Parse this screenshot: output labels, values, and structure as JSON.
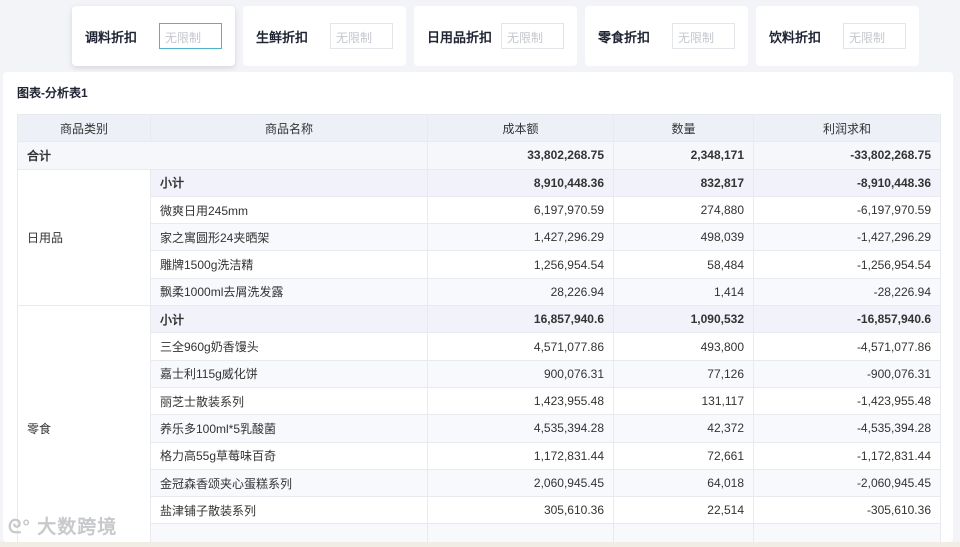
{
  "filters": [
    {
      "label": "调料折扣",
      "placeholder": "无限制"
    },
    {
      "label": "生鲜折扣",
      "placeholder": "无限制"
    },
    {
      "label": "日用品折扣",
      "placeholder": "无限制"
    },
    {
      "label": "零食折扣",
      "placeholder": "无限制"
    },
    {
      "label": "饮料折扣",
      "placeholder": "无限制"
    }
  ],
  "panel_title": "图表-分析表1",
  "columns": [
    "商品类别",
    "商品名称",
    "成本额",
    "数量",
    "利润求和"
  ],
  "total": {
    "label": "合计",
    "cost": "33,802,268.75",
    "qty": "2,348,171",
    "profit": "-33,802,268.75"
  },
  "groups": [
    {
      "category": "日用品",
      "subtotal": {
        "label": "小计",
        "cost": "8,910,448.36",
        "qty": "832,817",
        "profit": "-8,910,448.36"
      },
      "rows": [
        {
          "name": "微爽日用245mm",
          "cost": "6,197,970.59",
          "qty": "274,880",
          "profit": "-6,197,970.59"
        },
        {
          "name": "家之寓圆形24夹晒架",
          "cost": "1,427,296.29",
          "qty": "498,039",
          "profit": "-1,427,296.29"
        },
        {
          "name": "雕牌1500g洗洁精",
          "cost": "1,256,954.54",
          "qty": "58,484",
          "profit": "-1,256,954.54"
        },
        {
          "name": "飘柔1000ml去屑洗发露",
          "cost": "28,226.94",
          "qty": "1,414",
          "profit": "-28,226.94"
        }
      ]
    },
    {
      "category": "零食",
      "subtotal": {
        "label": "小计",
        "cost": "16,857,940.6",
        "qty": "1,090,532",
        "profit": "-16,857,940.6"
      },
      "rows": [
        {
          "name": "三全960g奶香馒头",
          "cost": "4,571,077.86",
          "qty": "493,800",
          "profit": "-4,571,077.86"
        },
        {
          "name": "嘉士利115g威化饼",
          "cost": "900,076.31",
          "qty": "77,126",
          "profit": "-900,076.31"
        },
        {
          "name": "丽芝士散装系列",
          "cost": "1,423,955.48",
          "qty": "131,117",
          "profit": "-1,423,955.48"
        },
        {
          "name": "养乐多100ml*5乳酸菌",
          "cost": "4,535,394.28",
          "qty": "42,372",
          "profit": "-4,535,394.28"
        },
        {
          "name": "格力高55g草莓味百奇",
          "cost": "1,172,831.44",
          "qty": "72,661",
          "profit": "-1,172,831.44"
        },
        {
          "name": "金冠森香颂夹心蛋糕系列",
          "cost": "2,060,945.45",
          "qty": "64,018",
          "profit": "-2,060,945.45"
        },
        {
          "name": "盐津铺子散装系列",
          "cost": "305,610.36",
          "qty": "22,514",
          "profit": "-305,610.36"
        }
      ]
    }
  ],
  "watermark": "大数跨境"
}
